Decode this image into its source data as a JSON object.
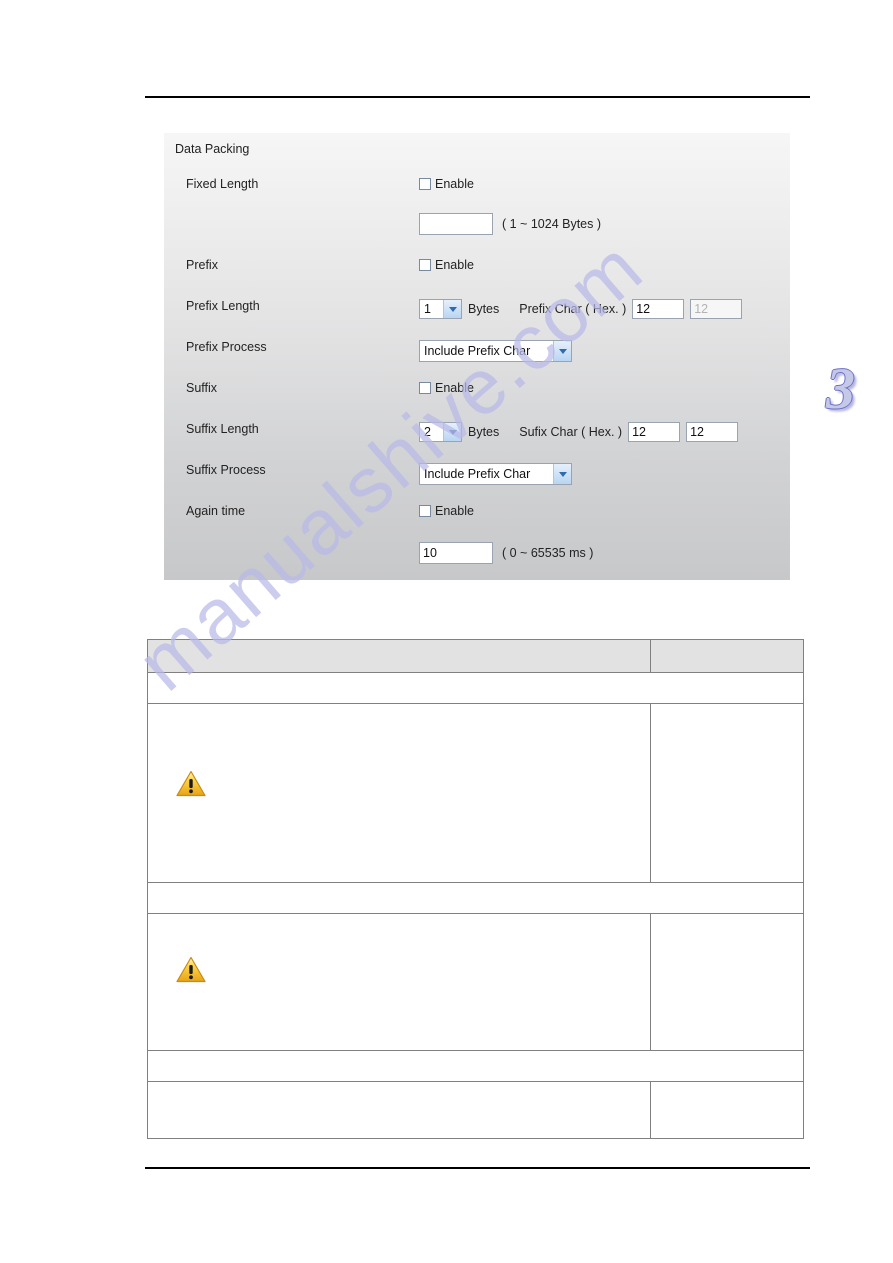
{
  "page": {
    "chapter_number": "3",
    "watermark": "manualshive.com"
  },
  "panel": {
    "title": "Data Packing",
    "rows": [
      {
        "label": "Fixed Length",
        "checkbox_label": "Enable"
      },
      {
        "input_value": "",
        "hint": "( 1 ~ 1024 Bytes )"
      },
      {
        "label": "Prefix",
        "checkbox_label": "Enable"
      },
      {
        "label": "Prefix Length",
        "length_value": "1",
        "unit": "Bytes",
        "char_label": "Prefix Char ( Hex. )",
        "char1": "12",
        "char2": "12"
      },
      {
        "label": "Prefix Process",
        "process_value": "Include Prefix Char"
      },
      {
        "label": "Suffix",
        "checkbox_label": "Enable"
      },
      {
        "label": "Suffix Length",
        "length_value": "2",
        "unit": "Bytes",
        "char_label": "Sufix Char ( Hex. )",
        "char1": "12",
        "char2": "12"
      },
      {
        "label": "Suffix Process",
        "process_value": "Include Prefix Char"
      },
      {
        "label": "Again time",
        "checkbox_label": "Enable"
      },
      {
        "input_value": "10",
        "hint": "( 0 ~ 65535 ms )"
      }
    ]
  },
  "description_table": {
    "header": {
      "col_main": "",
      "col_side": ""
    },
    "rows": [
      {
        "type": "header",
        "col_main": "",
        "col_side": ""
      },
      {
        "type": "span",
        "col_main": ""
      },
      {
        "type": "body",
        "col_main": "",
        "col_side": "",
        "icon": "warning-icon"
      },
      {
        "type": "span",
        "col_main": ""
      },
      {
        "type": "body",
        "col_main": "",
        "col_side": "",
        "icon": "warning-icon"
      },
      {
        "type": "span",
        "col_main": ""
      },
      {
        "type": "body",
        "col_main": "",
        "col_side": ""
      }
    ]
  }
}
